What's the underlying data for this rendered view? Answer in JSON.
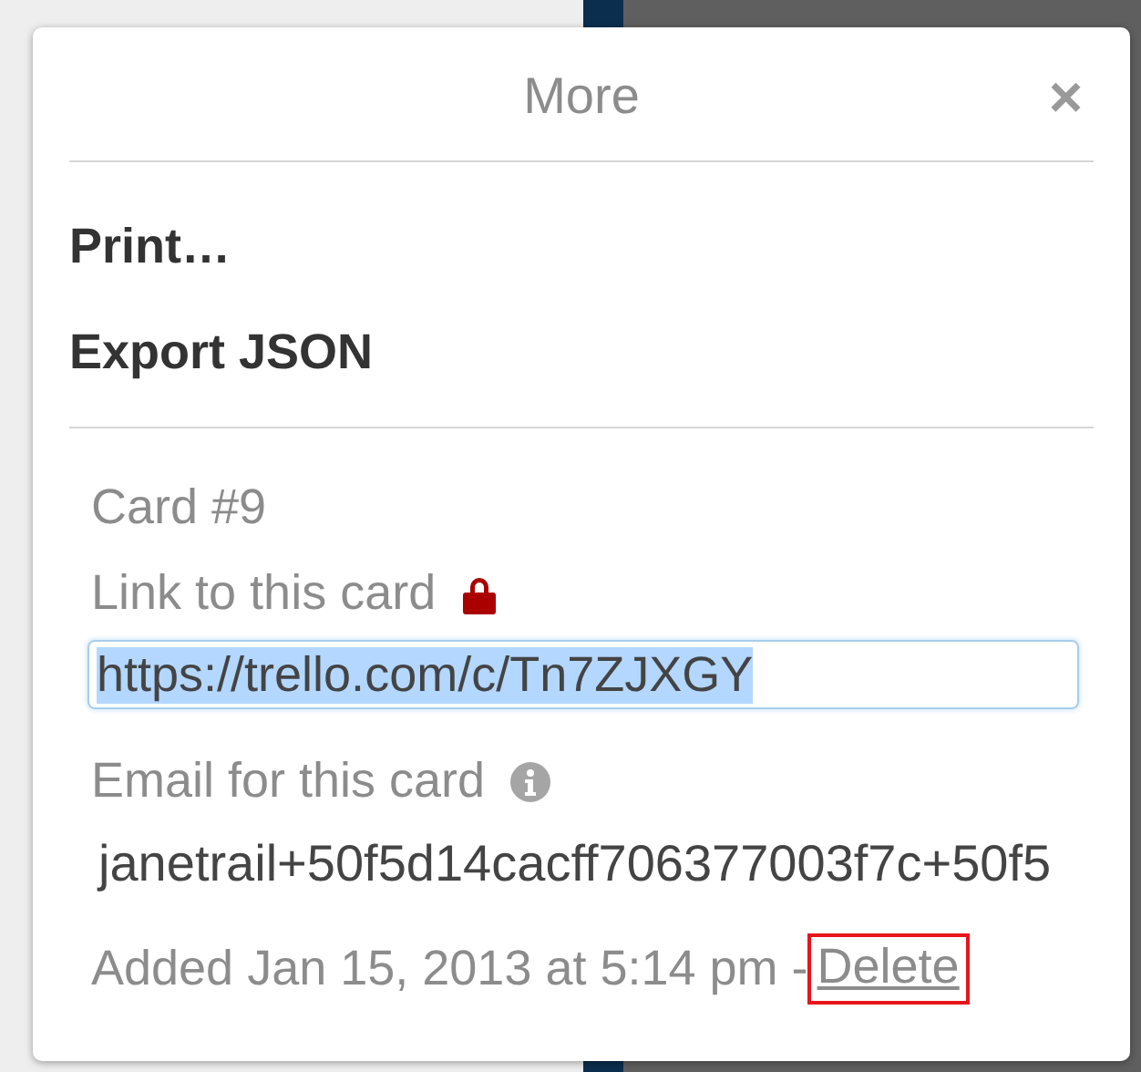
{
  "popover": {
    "title": "More",
    "close": "×"
  },
  "actions": [
    {
      "label": "Print…"
    },
    {
      "label": "Export JSON"
    }
  ],
  "card": {
    "number": "Card #9",
    "link_label": "Link to this card",
    "link_locked": true,
    "link_value": "https://trello.com/c/Tn7ZJXGY",
    "link_selected": true,
    "email_label": "Email for this card",
    "email_value": "janetrail+50f5d14cacff706377003f7c+50f5",
    "added": "Added Jan 15, 2013 at 5:14 pm -",
    "delete": "Delete",
    "delete_highlighted": true
  }
}
